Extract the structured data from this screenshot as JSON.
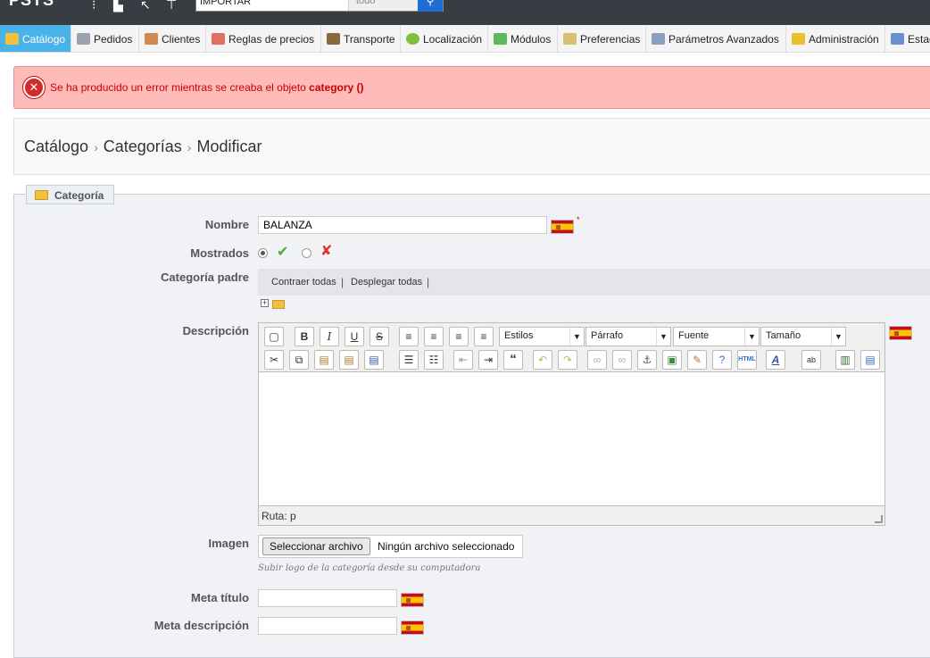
{
  "topbar": {
    "logo": "PSTS",
    "search": {
      "value": "IMPORTAR",
      "scope": "todo"
    }
  },
  "nav": {
    "items": [
      {
        "label": "Catálogo",
        "icon": "folder-icon",
        "active": true
      },
      {
        "label": "Pedidos",
        "icon": "cart-icon"
      },
      {
        "label": "Clientes",
        "icon": "user-icon"
      },
      {
        "label": "Reglas de precios",
        "icon": "price-rules-icon"
      },
      {
        "label": "Transporte",
        "icon": "truck-icon"
      },
      {
        "label": "Localización",
        "icon": "globe-icon"
      },
      {
        "label": "Módulos",
        "icon": "puzzle-icon"
      },
      {
        "label": "Preferencias",
        "icon": "preferences-icon"
      },
      {
        "label": "Parámetros Avanzados",
        "icon": "wrench-icon"
      },
      {
        "label": "Administración",
        "icon": "key-icon"
      },
      {
        "label": "Estadísticas",
        "icon": "stats-icon"
      }
    ]
  },
  "error": {
    "text": "Se ha producido un error mientras se creaba el objeto ",
    "object": "category ()"
  },
  "breadcrumb": {
    "items": [
      "Catálogo",
      "Categorías",
      "Modificar"
    ]
  },
  "form": {
    "legend": "Categoría",
    "name": {
      "label": "Nombre",
      "value": "BALANZA",
      "required": "*"
    },
    "displayed": {
      "label": "Mostrados",
      "selected": "yes"
    },
    "parent": {
      "label": "Categoría padre",
      "collapse": "Contraer todas",
      "expand": "Desplegar todas",
      "separator": "|"
    },
    "description": {
      "label": "Descripción",
      "selects": {
        "styles": "Estilos",
        "paragraph": "Párrafo",
        "font": "Fuente",
        "size": "Tamaño"
      },
      "path": "Ruta: p"
    },
    "image": {
      "label": "Imagen",
      "button": "Seleccionar archivo",
      "status": "Ningún archivo seleccionado",
      "hint": "Subir logo de la categoría desde su computadora"
    },
    "meta_title": {
      "label": "Meta título",
      "value": ""
    },
    "meta_description": {
      "label": "Meta descripción",
      "value": ""
    }
  },
  "colors": {
    "nav_active": "#49b2e8",
    "error_bg": "#ffbaba",
    "error_text": "#cc0000"
  }
}
